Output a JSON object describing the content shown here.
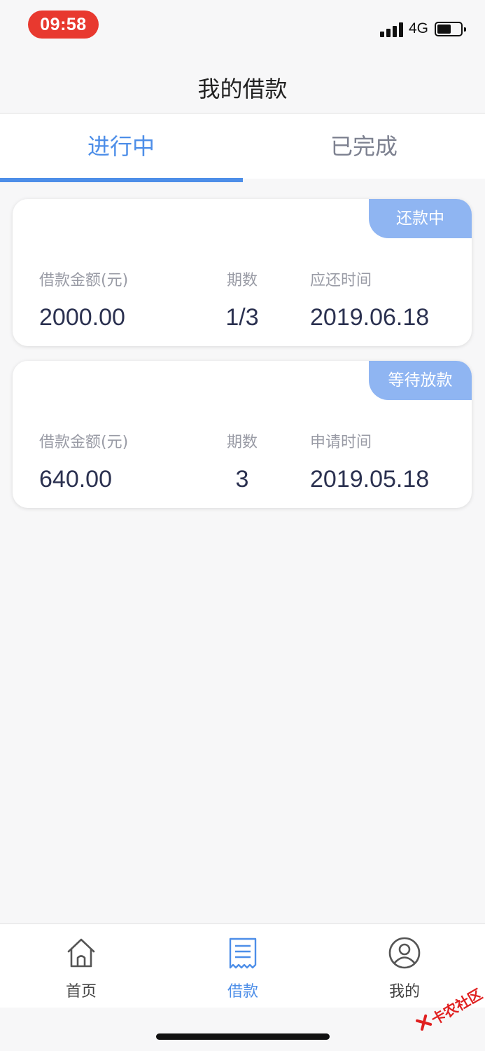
{
  "status_bar": {
    "time": "09:58",
    "network": "4G"
  },
  "header": {
    "title": "我的借款"
  },
  "tabs": [
    {
      "label": "进行中",
      "active": true
    },
    {
      "label": "已完成",
      "active": false
    }
  ],
  "loans": [
    {
      "status": "还款中",
      "amount_label": "借款金额(元)",
      "amount": "2000.00",
      "periods_label": "期数",
      "periods": "1/3",
      "date_label": "应还时间",
      "date": "2019.06.18"
    },
    {
      "status": "等待放款",
      "amount_label": "借款金额(元)",
      "amount": "640.00",
      "periods_label": "期数",
      "periods": "3",
      "date_label": "申请时间",
      "date": "2019.05.18"
    }
  ],
  "tabbar": [
    {
      "label": "首页",
      "icon": "home-icon",
      "active": false
    },
    {
      "label": "借款",
      "icon": "receipt-icon",
      "active": true
    },
    {
      "label": "我的",
      "icon": "profile-icon",
      "active": false
    }
  ],
  "watermark": {
    "text": "卡农社区"
  },
  "colors": {
    "accent": "#4d8ee8",
    "badge": "#8fb5f2",
    "time_pill": "#e8392f"
  }
}
